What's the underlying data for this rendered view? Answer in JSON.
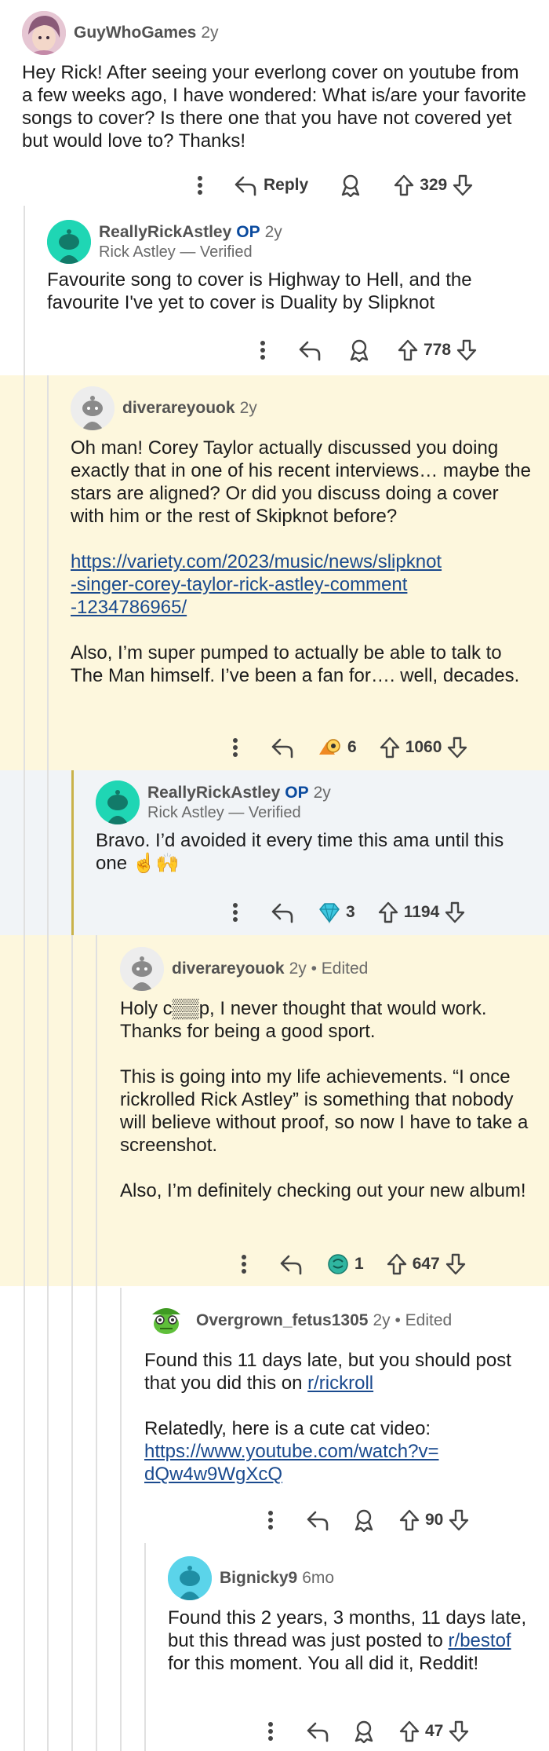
{
  "comments": {
    "c1": {
      "username": "GuyWhoGames",
      "age": "2y",
      "body": [
        "Hey Rick! After seeing your everlong cover on youtube from a few weeks ago, I have wondered: What is/are your favorite songs to cover? Is there one that you have not covered yet but would love to? Thanks!"
      ],
      "reply_label": "Reply",
      "votes": "329"
    },
    "c2": {
      "username": "ReallyRickAstley",
      "op": "OP",
      "age": "2y",
      "flair": "Rick Astley — Verified",
      "body": [
        "Favourite song to cover is Highway to Hell, and the favourite I've yet to cover is Duality by Slipknot"
      ],
      "votes": "778"
    },
    "c3": {
      "username": "diverareyouok",
      "age": "2y",
      "body_p1": "Oh man! Corey Taylor actually discussed you doing exactly that in one of his recent interviews… maybe the stars are aligned? Or did you discuss doing a cover with him or the rest of Skipknot before?",
      "link_l1": "https://variety.com/2023/music/news/slipknot",
      "link_l2": "-singer-corey-taylor-rick-astley-comment",
      "link_l3": "-1234786965/",
      "body_p3": "Also, I’m super pumped to actually be able to talk to The Man himself. I’ve been a fan for…. well, decades.",
      "award_count": "6",
      "votes": "1060"
    },
    "c4": {
      "username": "ReallyRickAstley",
      "op": "OP",
      "age": "2y",
      "flair": "Rick Astley — Verified",
      "body": "Bravo. I’d avoided it every time this ama until this one ☝🙌",
      "award_count": "3",
      "votes": "1194"
    },
    "c5": {
      "username": "diverareyouok",
      "age": "2y • Edited",
      "body_p1": "Holy c▒▒p, I never thought that would work. Thanks for being a good sport.",
      "body_p2": "This is going into my life achievements. “I once rickrolled Rick Astley” is something that nobody will believe without proof, so now I have to take a screenshot.",
      "body_p3": "Also, I’m definitely checking out your new album!",
      "award_count": "1",
      "votes": "647"
    },
    "c6": {
      "username": "Overgrown_fetus1305",
      "age": "2y • Edited",
      "body_p1_a": "Found this 11 days late, but you should post that you did this on ",
      "body_p1_link": "r/rickroll",
      "body_p2_a": "Relatedly, here is a cute cat video:",
      "link_l1": "https://www.youtube.com/watch?v=",
      "link_l2": "dQw4w9WgXcQ",
      "votes": "90"
    },
    "c7": {
      "username": "Bignicky9",
      "age": "6mo",
      "body_a": "Found this 2 years, 3 months, 11 days late, but this thread was just posted to ",
      "body_link": "r/bestof",
      "body_b": " for this moment. You all did it, Reddit!",
      "votes": "47"
    }
  },
  "colors": {
    "highlight_yellow": "#fdf7dd",
    "highlight_grey": "#f1f4f7",
    "link": "#1a4a8e",
    "op_blue": "#0a4a9e"
  },
  "icons": [
    "more-icon",
    "reply-icon",
    "award-icon",
    "upvote-icon",
    "downvote-icon",
    "avatar-icon"
  ]
}
